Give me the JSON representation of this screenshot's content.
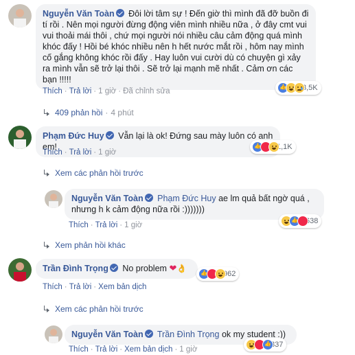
{
  "comments": [
    {
      "author": "Nguyễn Văn Toàn",
      "text": "Đôi lời tâm sự ! Đến giờ thì mình đã đỡ buồn đi tí rồi . Nên mọi người đừng động viên mình nhiều nữa , ở đây cmt vui vui thoải mái thôi , chứ mọi người nói nhiều câu cảm động quá mình khóc đấy ! Hồi bé khóc nhiều nên h hết nước mắt rồi , hôm nay mình cố gắng không khóc rồi đấy . Hay luôn vui cười dù có chuyện gì xảy ra mình vẫn sẽ trở lại thôi . Sẽ trở lại mạnh mẽ nhất . Cảm ơn các bạn !!!!!",
      "like": "Thích",
      "reply": "Trả lời",
      "time": "1 giờ",
      "edited": "Đã chỉnh sửa",
      "reaction_count": "3,5K",
      "replies_link": "409 phản hồi",
      "replies_time": "4 phút"
    },
    {
      "author": "Phạm Đức Huy",
      "text": "Vẫn lại là ok! Đứng sau mày luôn có anh em!",
      "like": "Thích",
      "reply": "Trả lời",
      "time": "1 giờ",
      "reaction_count": "1,1K",
      "prev_replies": "Xem các phản hồi trước",
      "reply_item": {
        "author": "Nguyễn Văn Toàn",
        "mention": "Phạm Đức Huy",
        "text": "ae lm quả bất ngờ quá , nhưng h k cảm động nữa rồi :)))))))",
        "like": "Thích",
        "reply": "Trả lời",
        "time": "1 giờ",
        "reaction_count": "638"
      },
      "more_replies": "Xem phản hồi khác"
    },
    {
      "author": "Trần Đình Trọng",
      "text": "No problem",
      "like": "Thích",
      "reply": "Trả lời",
      "translate": "Xem bản dịch",
      "reaction_count": "962",
      "prev_replies": "Xem các phản hồi trước",
      "reply_item": {
        "author": "Nguyễn Văn Toàn",
        "mention": "Trần Đình Trọng",
        "text": "ok my student :))",
        "like": "Thích",
        "reply": "Trả lời",
        "translate": "Xem bản dịch",
        "time": "1 giờ",
        "reaction_count": "337"
      }
    }
  ],
  "colors": {
    "link": "#385898",
    "bubble": "#f2f3f5",
    "muted": "#90949c"
  },
  "icons": [
    "verified-badge-icon",
    "like-reaction-icon",
    "love-reaction-icon",
    "haha-reaction-icon",
    "sad-reaction-icon",
    "reply-arrow-icon"
  ]
}
